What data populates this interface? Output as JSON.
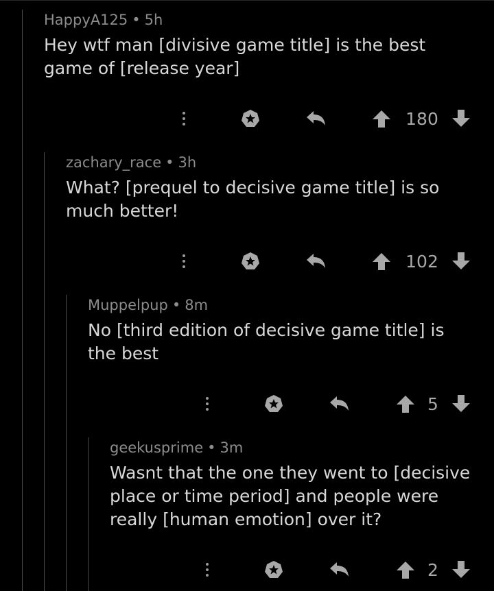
{
  "colors": {
    "background": "#000000",
    "text": "#d8d8d8",
    "meta": "#8c8c8c",
    "icon": "#a8a8a8",
    "thread_line": "#4a4a4a"
  },
  "comments": [
    {
      "author": "HappyA125",
      "separator": "•",
      "time": "5h",
      "text": "Hey wtf man [divisive game title] is the best game of [release year]",
      "score": "180",
      "icons": [
        "more-icon",
        "award-icon",
        "reply-icon",
        "upvote-icon",
        "downvote-icon"
      ]
    },
    {
      "author": "zachary_race",
      "separator": "•",
      "time": "3h",
      "text": "What? [prequel to decisive game title] is so much better!",
      "score": "102",
      "icons": [
        "more-icon",
        "award-icon",
        "reply-icon",
        "upvote-icon",
        "downvote-icon"
      ]
    },
    {
      "author": "Muppelpup",
      "separator": "•",
      "time": "8m",
      "text": "No [third edition of decisive game title] is the best",
      "score": "5",
      "icons": [
        "more-icon",
        "award-icon",
        "reply-icon",
        "upvote-icon",
        "downvote-icon"
      ]
    },
    {
      "author": "geekusprime",
      "separator": "•",
      "time": "3m",
      "text": "Wasnt that the one they went to [decisive place or time period] and people were really [human emotion] over it?",
      "score": "2",
      "icons": [
        "more-icon",
        "award-icon",
        "reply-icon",
        "upvote-icon",
        "downvote-icon"
      ]
    }
  ]
}
